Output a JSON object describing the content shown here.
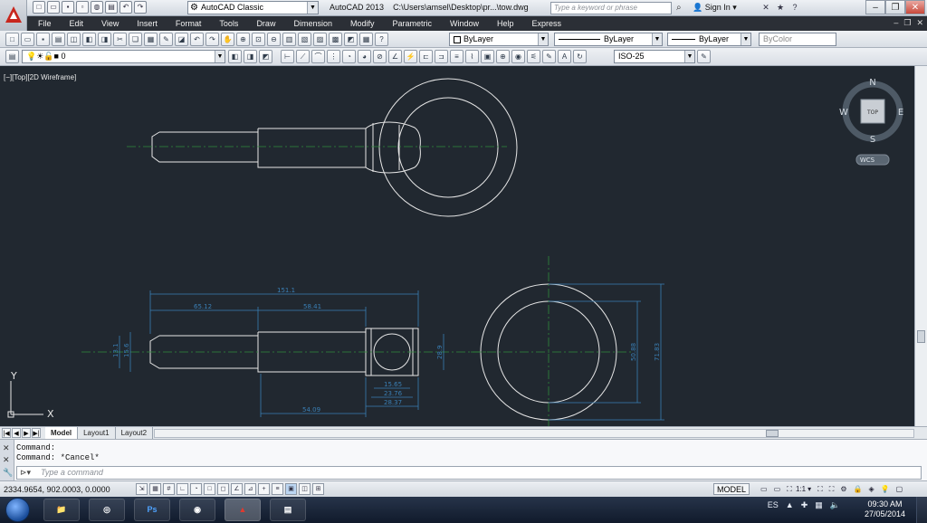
{
  "titlebar": {
    "workspace": "AutoCAD Classic",
    "app_name": "AutoCAD 2013",
    "file_path": "C:\\Users\\amsel\\Desktop\\pr...\\tow.dwg",
    "search_placeholder": "Type a keyword or phrase",
    "sign_in": "Sign In"
  },
  "menu": [
    "File",
    "Edit",
    "View",
    "Insert",
    "Format",
    "Tools",
    "Draw",
    "Dimension",
    "Modify",
    "Parametric",
    "Window",
    "Help",
    "Express"
  ],
  "properties": {
    "color": "ByLayer",
    "linetype": "ByLayer",
    "lineweight": "ByLayer",
    "plotstyle": "ByColor"
  },
  "layers": {
    "current_layer": "0",
    "dimstyle": "ISO-25"
  },
  "viewport": {
    "label": "[−][Top][2D Wireframe]"
  },
  "viewcube": {
    "face": "TOP",
    "north": "N",
    "south": "S",
    "east": "E",
    "west": "W",
    "ucs": "WCS"
  },
  "ucs_icon": {
    "y_label": "Y",
    "x_label": "X"
  },
  "dimensions": {
    "overall": "151.1",
    "left_seg": "65.12",
    "mid_seg": "58.41",
    "bottom_shaft": "54.09",
    "eye_inner": "15.65",
    "eye_mid": "23.76",
    "eye_outer": "28.37",
    "shaft_dia_small": "13.1",
    "shaft_dia_large": "15.6",
    "right_dim": "28.9",
    "ring_inner": "50.88",
    "ring_outer": "71.83"
  },
  "layout_tabs": [
    "Model",
    "Layout1",
    "Layout2"
  ],
  "command": {
    "history": [
      "Command:",
      "Command: *Cancel*"
    ],
    "placeholder": "Type a command"
  },
  "status": {
    "coordinates": "2334.9654, 902.0003, 0.0000",
    "model": "MODEL",
    "annotation_scale": "1:1"
  },
  "taskbar": {
    "language": "ES",
    "time": "09:30 AM",
    "date": "27/05/2014",
    "apps": [
      "folder",
      "autocad-ws",
      "Ps",
      "chrome",
      "autocad",
      "pad"
    ]
  },
  "colors": {
    "canvas": "#212830",
    "dim_color": "#3a7fb5",
    "center_color": "#2f8a3a",
    "geometry": "#e6e6e6"
  }
}
